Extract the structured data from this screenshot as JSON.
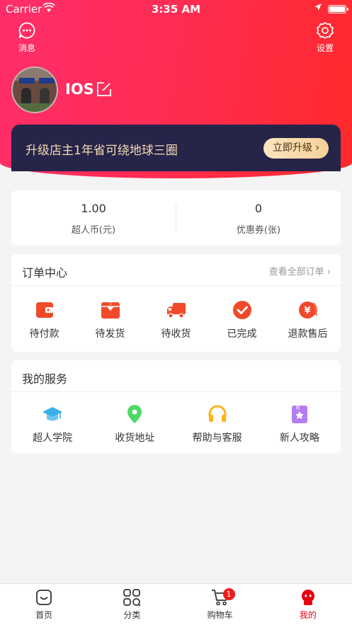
{
  "status_bar": {
    "carrier": "Carrier",
    "time": "3:35 AM"
  },
  "header": {
    "message_label": "消息",
    "settings_label": "设置",
    "nickname": "IOS"
  },
  "banner": {
    "text": "升级店主1年省可绕地球三圈",
    "button_label": "立即升级 ›"
  },
  "stats": [
    {
      "value": "1.00",
      "label": "超人币(元)"
    },
    {
      "value": "0",
      "label": "优惠券(张)"
    }
  ],
  "orders": {
    "title": "订单中心",
    "more_label": "查看全部订单 ›",
    "items": [
      {
        "label": "待付款",
        "icon": "wallet-icon"
      },
      {
        "label": "待发货",
        "icon": "package-icon"
      },
      {
        "label": "待收货",
        "icon": "truck-icon"
      },
      {
        "label": "已完成",
        "icon": "check-circle-icon"
      },
      {
        "label": "退款售后",
        "icon": "refund-icon"
      }
    ]
  },
  "services": {
    "title": "我的服务",
    "items": [
      {
        "label": "超人学院",
        "icon": "graduation-cap-icon"
      },
      {
        "label": "收货地址",
        "icon": "location-pin-icon"
      },
      {
        "label": "帮助与客服",
        "icon": "headphones-icon"
      },
      {
        "label": "新人攻略",
        "icon": "star-bookmark-icon"
      }
    ]
  },
  "tabbar": {
    "items": [
      {
        "label": "首页",
        "icon": "home-face-icon"
      },
      {
        "label": "分类",
        "icon": "category-grid-icon"
      },
      {
        "label": "购物车",
        "icon": "cart-icon",
        "badge": "1"
      },
      {
        "label": "我的",
        "icon": "profile-robot-icon",
        "active": true
      }
    ]
  },
  "colors": {
    "header_gradient_start": "#ff2e6a",
    "header_gradient_end": "#ff2a2a",
    "banner_bg": "#27244a",
    "banner_text": "#f6dcb1",
    "order_icon": "#f04a2a",
    "active_tab": "#e60012"
  }
}
